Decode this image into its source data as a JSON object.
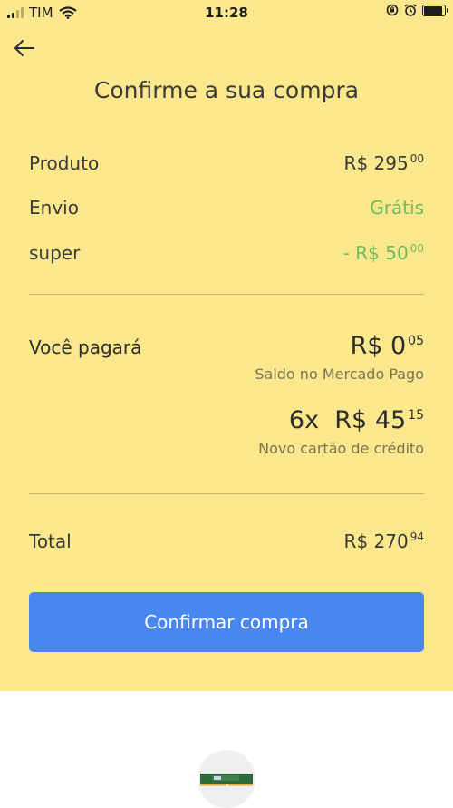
{
  "status_bar": {
    "carrier": "TIM",
    "time": "11:28"
  },
  "header": {
    "title": "Confirme a sua compra"
  },
  "summary": {
    "product": {
      "label": "Produto",
      "currency": "R$",
      "value": "295",
      "cents": "00"
    },
    "shipping": {
      "label": "Envio",
      "value": "Grátis"
    },
    "discount": {
      "label": "super",
      "prefix": "- R$",
      "value": "50",
      "cents": "00"
    }
  },
  "payment": {
    "label": "Você pagará",
    "balance": {
      "currency": "R$",
      "value": "0",
      "cents": "05",
      "method": "Saldo no Mercado Pago"
    },
    "installments": {
      "count": "6x",
      "currency": "R$",
      "value": "45",
      "cents": "15",
      "method": "Novo cartão de crédito"
    }
  },
  "total": {
    "label": "Total",
    "currency": "R$",
    "value": "270",
    "cents": "94"
  },
  "actions": {
    "confirm_label": "Confirmar compra"
  },
  "colors": {
    "background": "#fbe78c",
    "accent": "#4a86ef",
    "positive": "#6dbb5d"
  }
}
